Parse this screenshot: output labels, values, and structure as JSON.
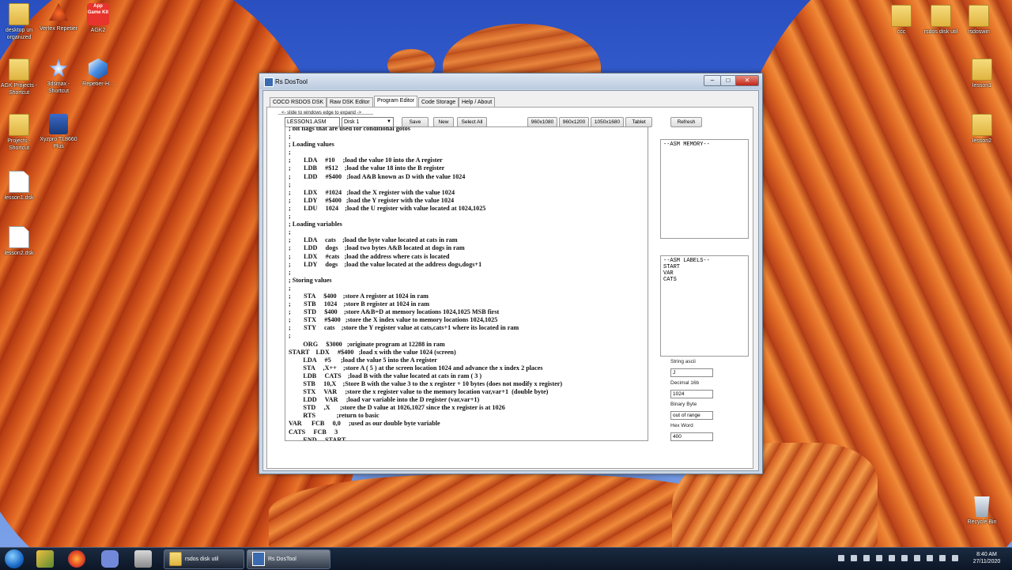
{
  "desktop": {
    "icons": [
      {
        "label": "desktop un organized"
      },
      {
        "label": "Vertex Repetier"
      },
      {
        "label": "AGK2",
        "art": "App Game Kit"
      },
      {
        "label": "AGK Projects - Shortcut"
      },
      {
        "label": "3dsmax - Shortcut"
      },
      {
        "label": "Repetier-H..."
      },
      {
        "label": "Projects - Shortcut"
      },
      {
        "label": "Xyzpro TL8660 Plus"
      },
      {
        "label": "lesson1.dsk"
      },
      {
        "label": "lesson2.dsk"
      },
      {
        "label": "ccc"
      },
      {
        "label": "rsdos disk util"
      },
      {
        "label": "rsdoswin"
      },
      {
        "label": "lesson1"
      },
      {
        "label": "lesson2"
      },
      {
        "label": "Recycle Bin"
      }
    ]
  },
  "window": {
    "title": "Rs DosTool",
    "controls": {
      "minimize": "–",
      "maximize": "□",
      "close": "✕"
    },
    "tabs": [
      {
        "label": "COCO RSDOS DSK"
      },
      {
        "label": "Raw DSK Editor"
      },
      {
        "label": "Program Editor"
      },
      {
        "label": "Code Storage"
      },
      {
        "label": "Help / About"
      }
    ],
    "hint": "<- slide to windows edge to expand ->",
    "toolbar": {
      "filename": "LESSON1.ASM",
      "disk_select": "Disk 1",
      "save": "Save",
      "new": "New",
      "select_all": "Select All",
      "res1": "960x1080",
      "res2": "960x1200",
      "res3": "1050x1680",
      "tablet": "Tablet",
      "refresh": "Refresh"
    },
    "code_lines": [
      "; bit flags that are used for conditional gotos",
      ";",
      "; Loading values",
      ";",
      ";        LDA     #10     ;load the value 10 into the A register",
      ";        LDB     #$12    ;load the value 18 into the B register",
      ";        LDD     #$400   ;load A&B known as D with the value 1024",
      ";",
      ";        LDX     #1024   ;load the X register with the value 1024",
      ";        LDY     #$400   ;load the Y register with the value 1024",
      ";        LDU     1024    ;load the U register with value located at 1024,1025",
      ";",
      "; Loading variables",
      ";",
      ";        LDA     cats    ;load the byte value located at cats in ram",
      ";        LDD     dogs    ;load two bytes A&B located at dogs in ram",
      ";        LDX     #cats   ;load the address where cats is located",
      ";        LDY     dogs    ;load the value located at the address dogs,dogs+1",
      ";",
      "; Storing values",
      ";",
      ";        STA     $400    ;store A register at 1024 in ram",
      ";        STB     1024    ;store B register at 1024 in ram",
      ";        STD     $400    ;store A&B=D at memory locations 1024,1025 MSB first",
      ";        STX     #$400   ;store the X index value to memory locations 1024,1025",
      ";        STY     cats    ;store the Y register value at cats,cats+1 where its located in ram",
      ";",
      "         ORG     $3000   ;originate program at 12288 in ram",
      "START    LDX     #$400   ;load x with the value 1024 (screen)",
      "         LDA     #5      ;load the value 5 into the A register",
      "         STA     ,X++    ;store A ( 5 ) at the screen location 1024 and advance the x index 2 places",
      "         LDB     CATS    ;load B with the value located at cats in ram ( 3 )",
      "         STB     10,X    ;Store B with the value 3 to the x register + 10 bytes (does not modify x register)",
      "         STX     VAR     ;store the x register value to the memory location var,var+1  (double byte)",
      "         LDD     VAR     ;load var variable into the D register (var,var+1)",
      "         STD     ,X      ;store the D value at 1026,1027 since the x register is at 1026",
      "         RTS             ;return to basic",
      "VAR      FCB     0,0     ;used as our double byte variable",
      "CATS     FCB     3",
      "         END     START"
    ],
    "asm_memory": "--ASM MEMORY--",
    "asm_labels": "--ASM LABELS--\nSTART\nVAR\nCATS",
    "converter": {
      "string_ascii_label": "String ascii",
      "string_ascii_value": "J",
      "decimal_label": "Decimal 16b",
      "decimal_value": "1024",
      "binary_label": "Binary Byte",
      "binary_value": "out of range",
      "hex_label": "Hex Word",
      "hex_value": "400"
    }
  },
  "taskbar": {
    "tasks": [
      {
        "label": "rsdos disk util"
      },
      {
        "label": "Rs DosTool"
      }
    ],
    "time": "8:40 AM",
    "date": "27/11/2020"
  }
}
